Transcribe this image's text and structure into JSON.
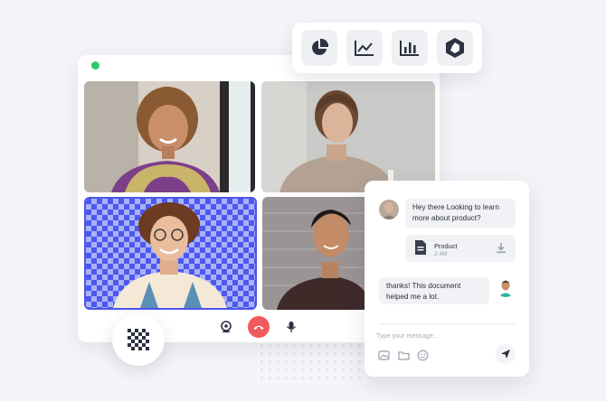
{
  "colors": {
    "background": "#f4f5f8",
    "status_online": "#33c76b",
    "end_call": "#f2595b",
    "highlight_border": "#4b57e8",
    "checker_a": "#4c58f0",
    "checker_b": "#a9b2f6"
  },
  "video_grid": {
    "participants": [
      {
        "name": "participant-1",
        "icon": "person"
      },
      {
        "name": "participant-2",
        "icon": "person"
      },
      {
        "name": "participant-3",
        "icon": "person",
        "background": "transparent-checkerboard",
        "active_speaker": true
      },
      {
        "name": "participant-4",
        "icon": "person"
      }
    ]
  },
  "call_controls": {
    "icons": [
      "webcam-icon",
      "phone-hangup-icon",
      "microphone-icon"
    ]
  },
  "chart_toolbar": {
    "icons": [
      "pie-chart-icon",
      "line-chart-icon",
      "bar-chart-icon",
      "hexagon-icon"
    ]
  },
  "chat": {
    "messages": [
      {
        "from": "incoming",
        "text_line1": "Hey there Looking to learn",
        "text_line2": "more about product?"
      },
      {
        "from": "outgoing",
        "text_line1": "thanks!  This document",
        "text_line2": "helped me a lot."
      }
    ],
    "attachment": {
      "name": "Product",
      "size": "2.4M",
      "icon": "document-icon",
      "action_icon": "download-icon"
    },
    "input_placeholder": "Type your message...",
    "input_icons": [
      "image-icon",
      "folder-icon",
      "emoji-icon"
    ],
    "send_icon": "send-icon"
  },
  "grid_button_icon": "checker-grid-icon"
}
